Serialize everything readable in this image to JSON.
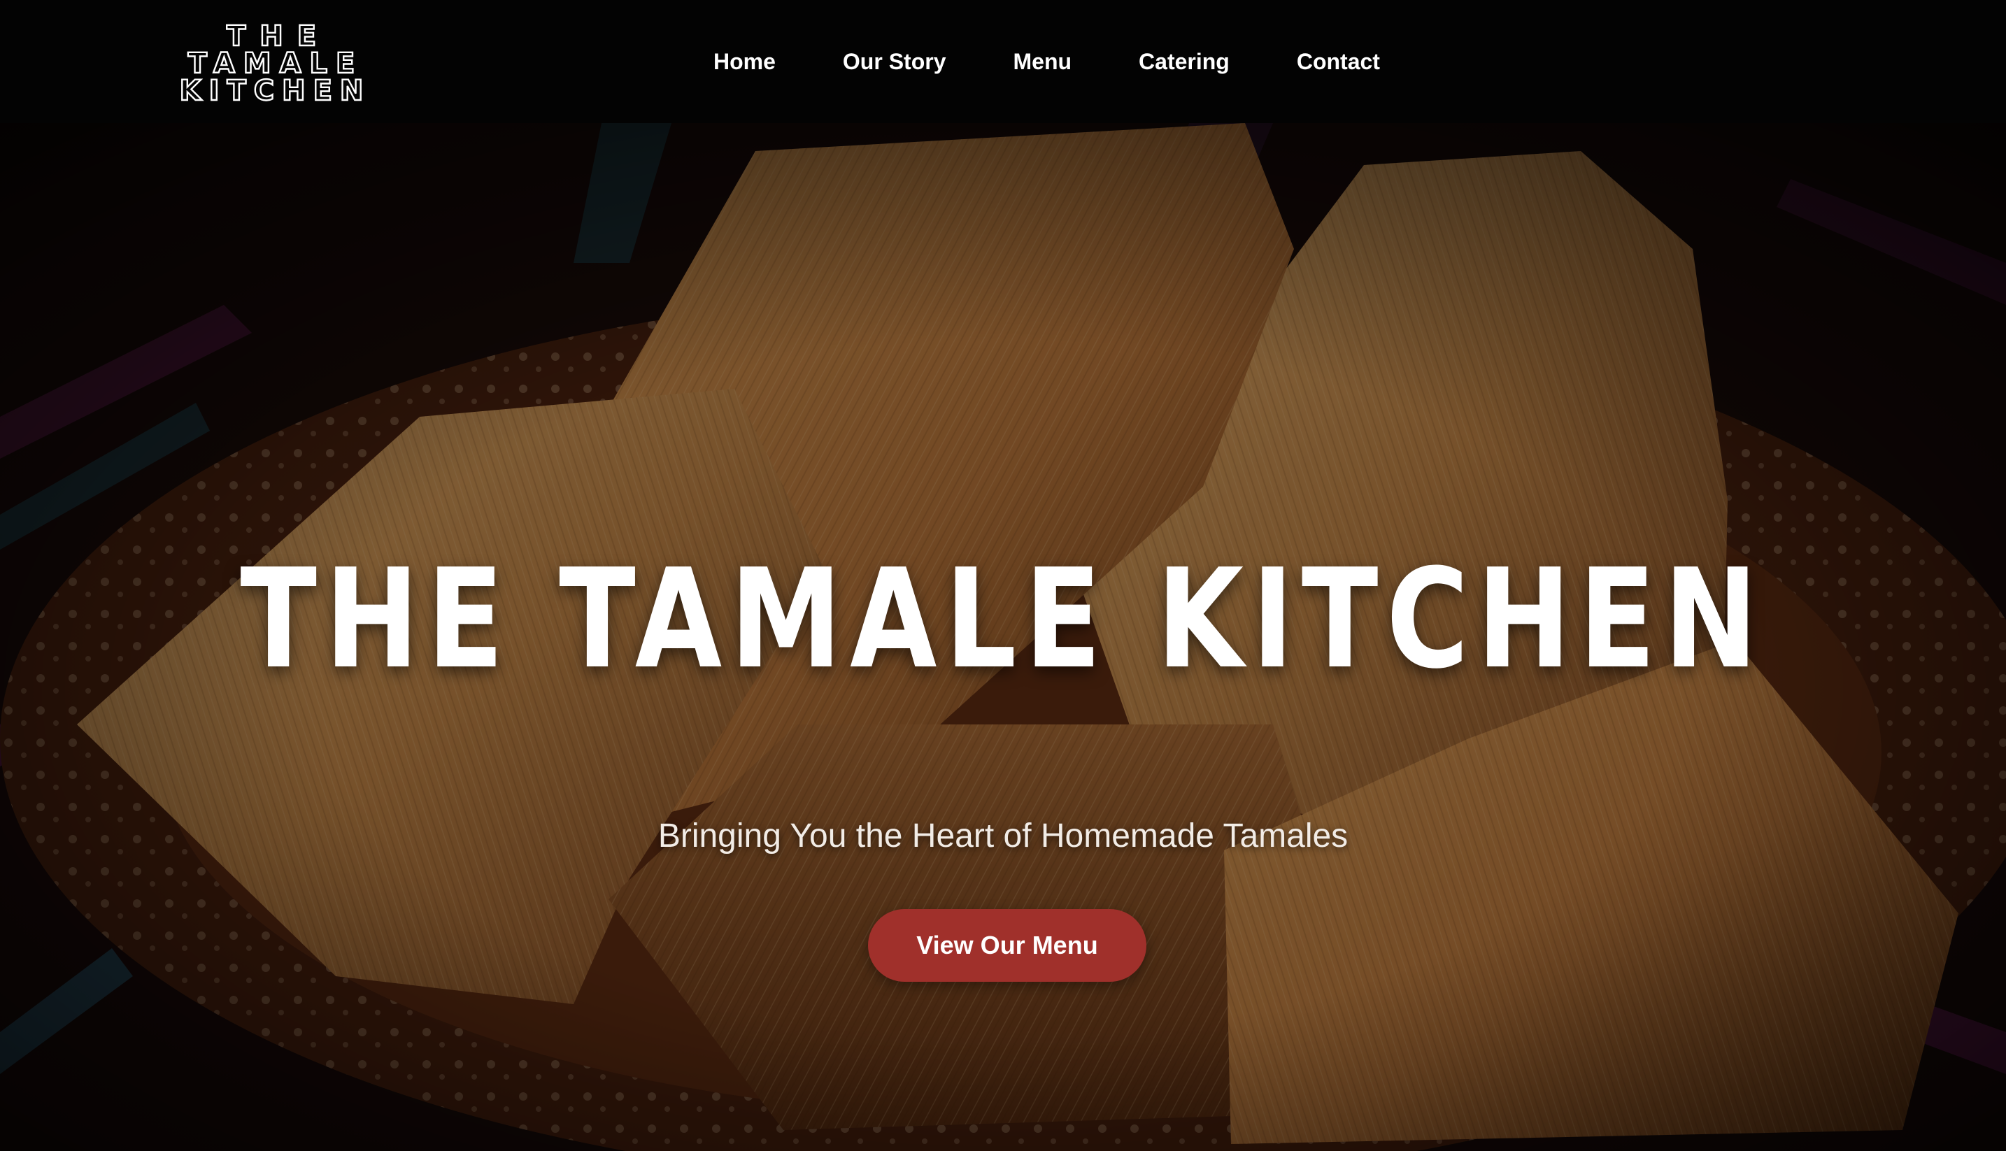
{
  "brand": {
    "logo_lines": [
      "THE",
      "TAMALE",
      "KITCHEN"
    ]
  },
  "nav": {
    "items": [
      {
        "label": "Home"
      },
      {
        "label": "Our Story"
      },
      {
        "label": "Menu"
      },
      {
        "label": "Catering"
      },
      {
        "label": "Contact"
      }
    ]
  },
  "hero": {
    "title": "THE TAMALE KITCHEN",
    "subtitle": "Bringing You the Heart of Homemade Tamales",
    "cta_label": "View Our Menu",
    "background_image": "tamales-in-corn-husks-on-clay-plate"
  },
  "colors": {
    "nav_background": "#030303",
    "cta_background": "#a0302b",
    "text": "#ffffff",
    "husk_light": "#c98a45",
    "husk_dark": "#7a4318",
    "plate": "#5a2a12"
  }
}
